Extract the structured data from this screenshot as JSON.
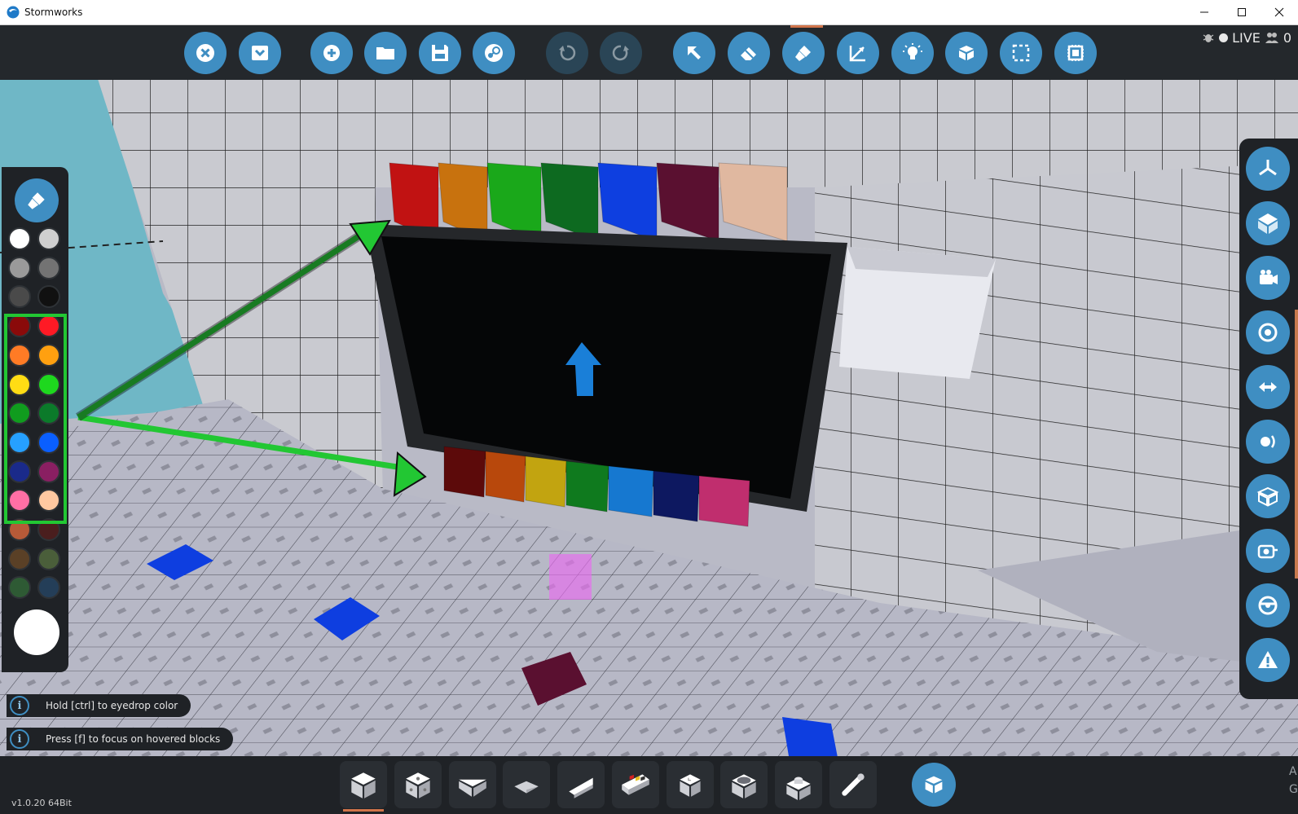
{
  "window": {
    "title": "Stormworks",
    "minimize_label": "Minimize",
    "maximize_label": "Maximize",
    "close_label": "Close"
  },
  "top_toolbar": {
    "buttons": [
      {
        "name": "close-workbench",
        "icon": "x-circle-icon"
      },
      {
        "name": "dropdown-menu",
        "icon": "chevron-down-icon"
      },
      {
        "name": "new-vehicle",
        "icon": "plus-icon"
      },
      {
        "name": "open-vehicle",
        "icon": "folder-icon"
      },
      {
        "name": "save-vehicle",
        "icon": "floppy-icon"
      },
      {
        "name": "steam-workshop",
        "icon": "steam-icon"
      },
      {
        "name": "undo",
        "icon": "undo-icon",
        "enabled": false
      },
      {
        "name": "redo",
        "icon": "redo-icon",
        "enabled": false
      },
      {
        "name": "select-tool",
        "icon": "cursor-arrow-icon"
      },
      {
        "name": "eraser-tool",
        "icon": "eraser-icon"
      },
      {
        "name": "paint-tool",
        "icon": "paint-brush-icon"
      },
      {
        "name": "axis-tool",
        "icon": "axis-icon"
      },
      {
        "name": "lights-tool",
        "icon": "bulb-icon"
      },
      {
        "name": "logic-tool",
        "icon": "blocks-icon"
      },
      {
        "name": "selection-box-tool",
        "icon": "dashed-square-icon"
      },
      {
        "name": "microcontroller-tool",
        "icon": "chip-icon"
      }
    ],
    "status": {
      "live_label": "LIVE",
      "player_count": "0"
    }
  },
  "palette": {
    "active_color": "#ffffff",
    "swatches": [
      "#ffffff",
      "#cfcfcf",
      "#9a9a9a",
      "#737373",
      "#4a4a4a",
      "#111111",
      "#8a0a0a",
      "#ff1a25",
      "#ff7b25",
      "#ffa010",
      "#ffdc14",
      "#1ed81e",
      "#109c1e",
      "#0b7a2a",
      "#26a0ff",
      "#0a5fff",
      "#1a2a8a",
      "#8a1f62",
      "#ff6fa5",
      "#ffc8a0",
      "#b65a38",
      "#4a1e1e",
      "#5a4026",
      "#4a5e3a",
      "#2e5a34",
      "#243e58"
    ]
  },
  "right_panel": {
    "buttons": [
      {
        "name": "view-axis",
        "icon": "tri-axis-icon"
      },
      {
        "name": "view-cube",
        "icon": "cube-axis-icon"
      },
      {
        "name": "camera",
        "icon": "camera-icon"
      },
      {
        "name": "center-of-mass",
        "icon": "target-icon"
      },
      {
        "name": "transfer",
        "icon": "arrows-icon"
      },
      {
        "name": "buoyancy",
        "icon": "sound-icon"
      },
      {
        "name": "block-count",
        "icon": "box-icon"
      },
      {
        "name": "screenshot",
        "icon": "camera-tag-icon"
      },
      {
        "name": "controls",
        "icon": "steering-icon"
      },
      {
        "name": "warnings",
        "icon": "warning-icon"
      }
    ]
  },
  "hints": [
    {
      "text": "Hold [ctrl] to eyedrop color"
    },
    {
      "text": "Press [f] to focus on hovered blocks"
    }
  ],
  "bottom_bar": {
    "slots": [
      {
        "name": "block",
        "icon": "cube-icon",
        "selected": true
      },
      {
        "name": "block-dots",
        "icon": "cube-dots-icon"
      },
      {
        "name": "wedge",
        "icon": "wedge-icon"
      },
      {
        "name": "flat-pyramid",
        "icon": "pyramid-icon"
      },
      {
        "name": "slope",
        "icon": "slope-icon"
      },
      {
        "name": "buttons-panel",
        "icon": "panel-icon"
      },
      {
        "name": "small-block",
        "icon": "small-cube-icon"
      },
      {
        "name": "round-block",
        "icon": "round-cube-icon"
      },
      {
        "name": "knob-block",
        "icon": "knob-cube-icon"
      },
      {
        "name": "pipe",
        "icon": "pipe-icon"
      }
    ],
    "build_button_icon": "blocks-icon"
  },
  "version": "v1.0.20 64Bit",
  "edge_text": [
    "A",
    "G"
  ],
  "scene": {
    "top_strip_colors": [
      "#c11212",
      "#c8720e",
      "#1aa81a",
      "#0d6a20",
      "#0e3fe0",
      "#5a1030",
      "#e0b8a0"
    ],
    "bottom_strip_colors": [
      "#5c0a0a",
      "#b8480c",
      "#c2a410",
      "#0f7a1e",
      "#1678d0",
      "#0d1860",
      "#c02e6e"
    ],
    "arrow_color": "#22c733",
    "monitor_arrow_color": "#1a7fd8"
  }
}
